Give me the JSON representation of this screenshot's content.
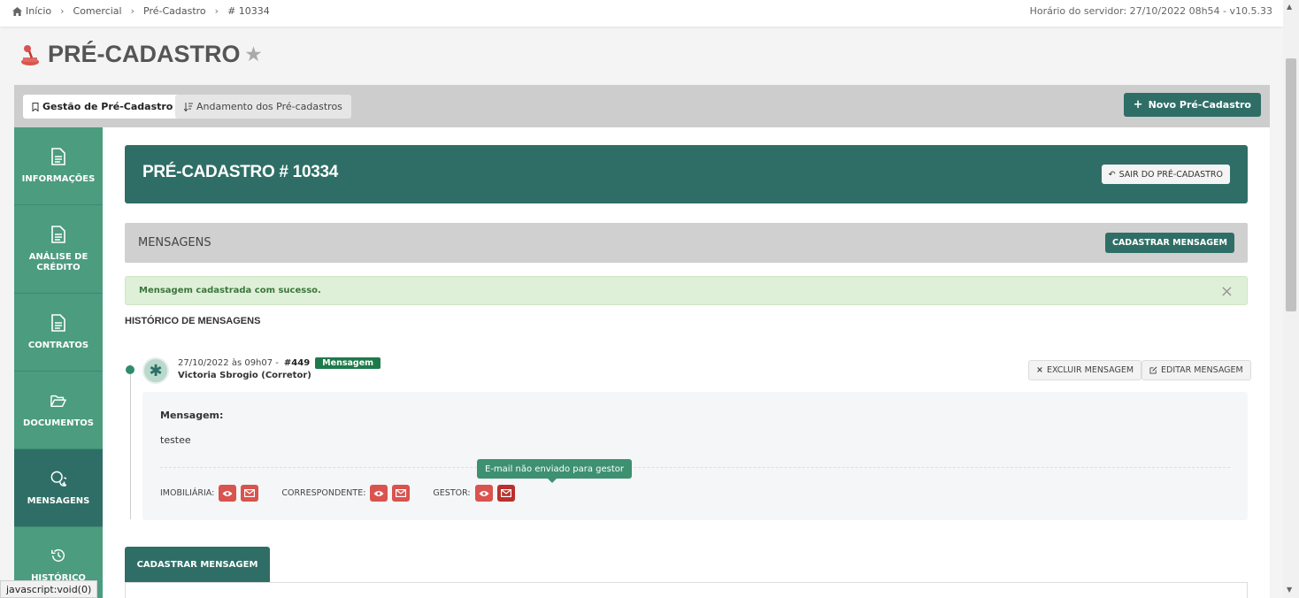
{
  "breadcrumb": {
    "items": [
      "Início",
      "Comercial",
      "Pré-Cadastro",
      "# 10334"
    ]
  },
  "server_time": "Horário do servidor: 27/10/2022 08h54 - v10.5.33",
  "page": {
    "title": "PRÉ-CADASTRO",
    "icon": "joystick-icon",
    "favorite_icon": "star-icon"
  },
  "tabs": [
    {
      "label": "Gestão de Pré-Cadastro",
      "icon": "bookmark-icon",
      "active": true
    },
    {
      "label": "Andamento dos Pré-cadastros",
      "icon": "sort-icon",
      "active": false
    }
  ],
  "new_button": {
    "label": "Novo Pré-Cadastro",
    "icon": "plus-icon"
  },
  "sidebar": {
    "items": [
      {
        "label": "INFORMAÇÕES",
        "icon": "file-icon"
      },
      {
        "label": "ANÁLISE DE CRÉDITO",
        "icon": "file-icon"
      },
      {
        "label": "CONTRATOS",
        "icon": "file-icon"
      },
      {
        "label": "DOCUMENTOS",
        "icon": "folder-open-icon"
      },
      {
        "label": "MENSAGENS",
        "icon": "chat-icon",
        "active": true
      },
      {
        "label": "HISTÓRICO",
        "icon": "history-icon"
      }
    ]
  },
  "header": {
    "title": "PRÉ-CADASTRO # 10334",
    "exit_button": "SAIR DO PRÉ-CADASTRO"
  },
  "messages_bar": {
    "title": "MENSAGENS",
    "register_button": "CADASTRAR MENSAGEM"
  },
  "alert": {
    "text": "Mensagem cadastrada com sucesso.",
    "close": "×"
  },
  "history": {
    "title": "HISTÓRICO DE MENSAGENS",
    "entries": [
      {
        "datetime": "27/10/2022 às 09h07 -",
        "number": "#449",
        "badge": "Mensagem",
        "author": "Victoria Sbrogio (Corretor)",
        "delete_button": "EXCLUIR MENSAGEM",
        "edit_button": "EDITAR MENSAGEM",
        "message_label": "Mensagem:",
        "message_text": "testee",
        "recipients": [
          {
            "label": "IMOBILIÁRIA:"
          },
          {
            "label": "CORRESPONDENTE:"
          },
          {
            "label": "GESTOR:"
          }
        ],
        "tooltip": "E-mail não enviado para gestor"
      }
    ]
  },
  "form_tab": "CADASTRAR MENSAGEM",
  "status_bar": "javascript:void(0)",
  "colors": {
    "primary": "#2f6e66",
    "sidebar": "#4c9c80",
    "danger": "#d9534f",
    "success_bg": "#dff0d8",
    "success_text": "#3c763d"
  }
}
